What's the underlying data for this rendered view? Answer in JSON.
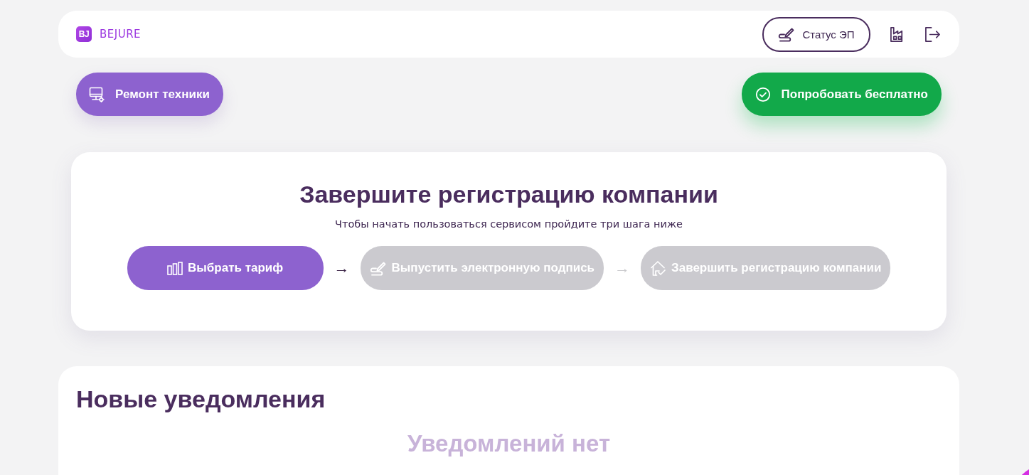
{
  "header": {
    "logo": {
      "mark": "BJ",
      "name": "BEJURE"
    },
    "status_button": {
      "label": "Статус ЭП"
    }
  },
  "actions": [
    {
      "label": "Ремонт техники",
      "kind": "repair"
    },
    {
      "label": "Попробовать бесплатно",
      "kind": "trial"
    }
  ],
  "registration": {
    "title": "Завершите регистрацию компании",
    "subtitle": "Чтобы начать пользоваться сервисом пройдите три шага ниже",
    "steps": [
      {
        "label": "Выбрать тариф",
        "disabled": false
      },
      {
        "label": "Выпустить электронную подпись",
        "disabled": true
      },
      {
        "label": "Завершить регистрацию компании",
        "disabled": true
      }
    ],
    "arrows": [
      {
        "text": "→",
        "disabled": false
      },
      {
        "text": "→",
        "disabled": true
      }
    ]
  },
  "notifications": {
    "title": "Новые уведомления",
    "empty_text": "Уведомлений нет"
  }
}
